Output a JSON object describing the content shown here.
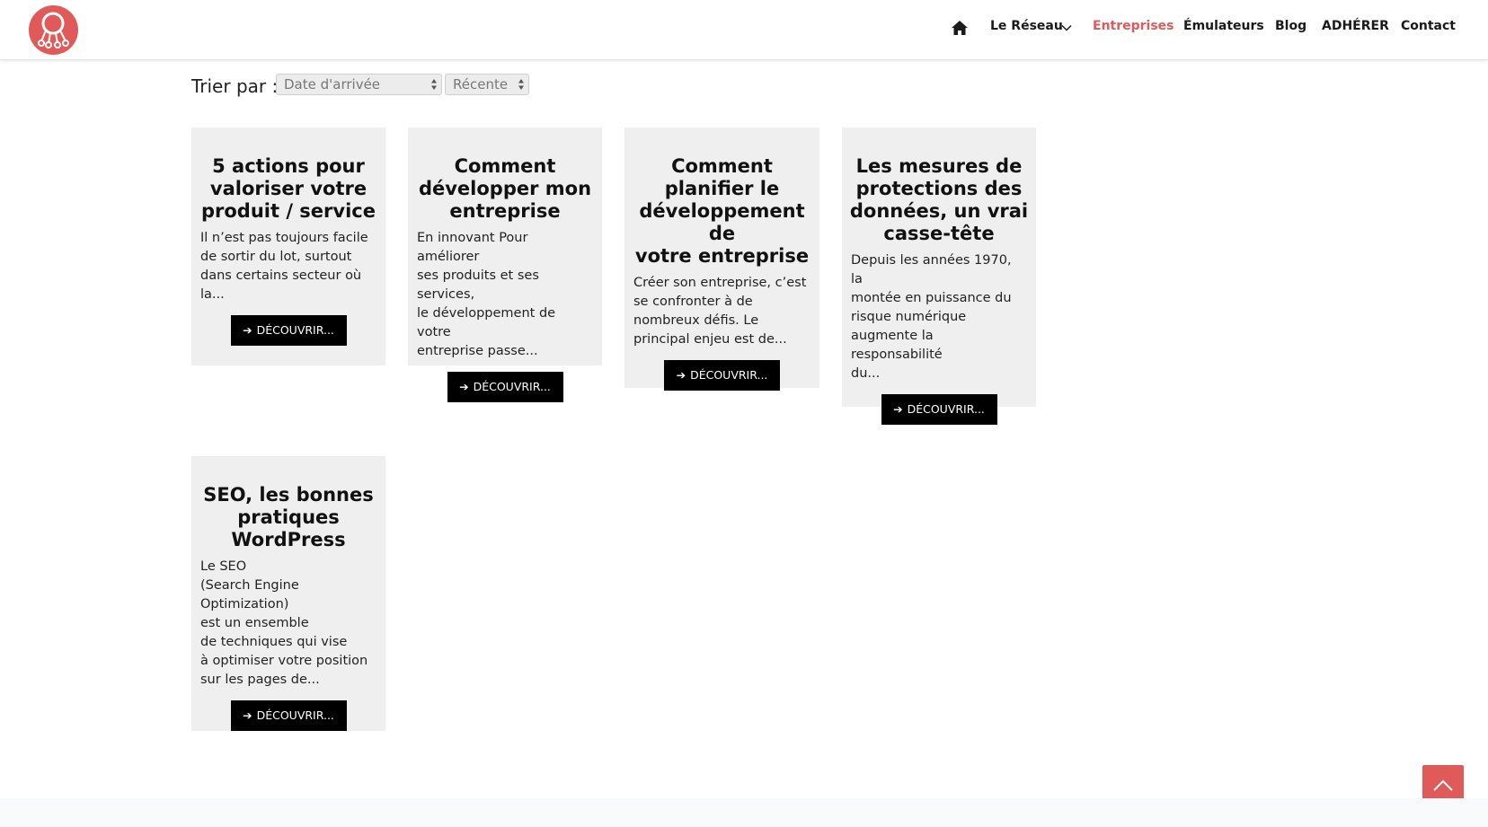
{
  "header": {
    "nav": {
      "reseau": "Le Réseau",
      "entreprises": "Entreprises",
      "emulateurs": "Émulateurs",
      "blog": "Blog",
      "adherer": "ADHÉRER",
      "contact": "Contact"
    },
    "accent_color": "#e05a5a"
  },
  "sort": {
    "label": "Trier par :",
    "field_value": "Date d'arrivée",
    "order_value": "Récente"
  },
  "cards": [
    {
      "title": [
        "5 actions pour",
        "valoriser votre",
        "produit / service"
      ],
      "excerpt": [
        "Il n’est pas toujours facile",
        "de sortir du lot, surtout",
        "dans certains secteur où",
        "la..."
      ],
      "button": "DÉCOUVRIR..."
    },
    {
      "title": [
        "Comment",
        "développer mon",
        "entreprise"
      ],
      "excerpt": [
        "En innovant Pour améliorer",
        "ses produits et ses services,",
        "le développement de votre",
        "entreprise passe..."
      ],
      "button": "DÉCOUVRIR..."
    },
    {
      "title": [
        "Comment",
        "planifier le",
        "développement de",
        "votre entreprise"
      ],
      "excerpt": [
        "Créer son entreprise, c’est",
        "se confronter à de",
        "nombreux défis. Le",
        "principal enjeu est de..."
      ],
      "button": "DÉCOUVRIR..."
    },
    {
      "title": [
        "Les mesures de",
        "protections des",
        "données, un vrai",
        "casse-tête"
      ],
      "excerpt": [
        "Depuis les années 1970, la",
        "montée en puissance du",
        "risque numérique",
        "augmente la responsabilité",
        "du..."
      ],
      "button": "DÉCOUVRIR..."
    },
    {
      "title": [
        "SEO, les bonnes",
        "pratiques",
        "WordPress"
      ],
      "excerpt": [
        "Le SEO",
        "(Search Engine Optimization)",
        "est un ensemble",
        "de techniques qui vise",
        "à optimiser votre position",
        "sur les pages de..."
      ],
      "button": "DÉCOUVRIR..."
    }
  ]
}
